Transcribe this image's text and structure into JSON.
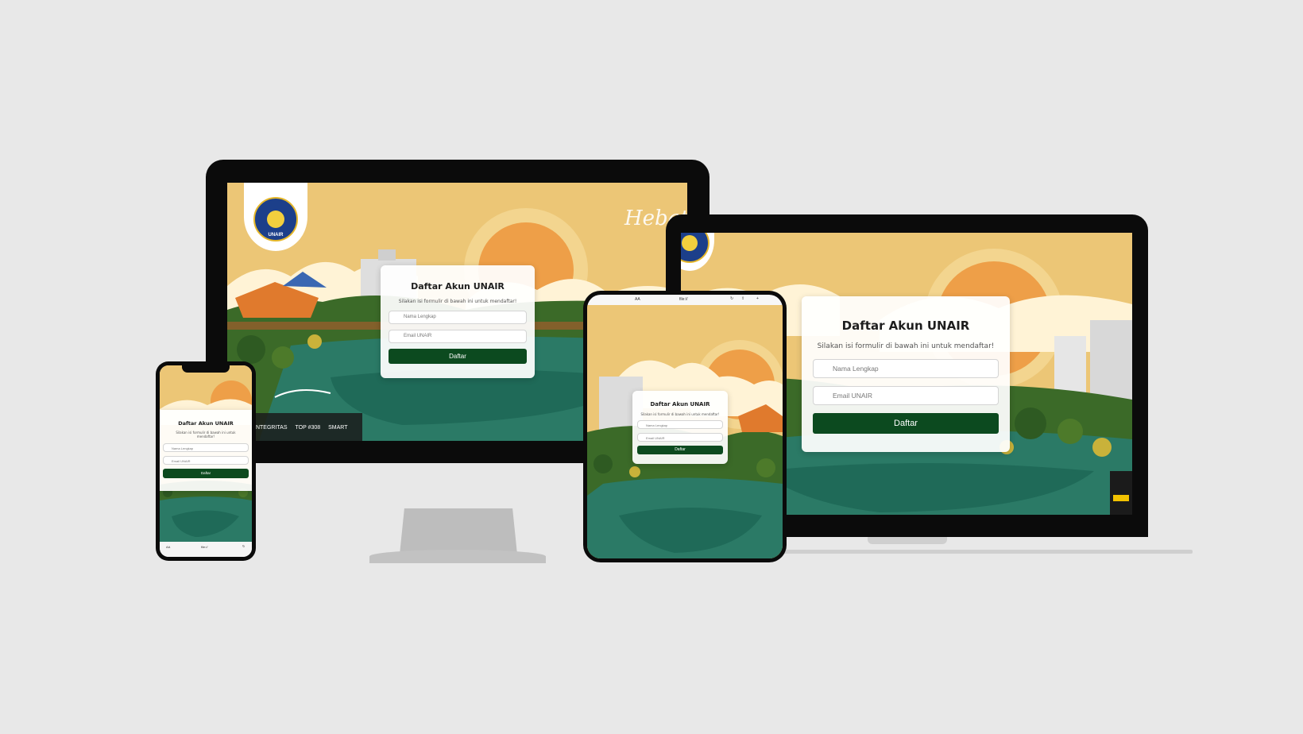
{
  "form": {
    "title": "Daftar Akun UNAIR",
    "subtitle": "Silakan isi formulir di bawah ini untuk mendaftar!",
    "name_placeholder": "Nama Lengkap",
    "email_placeholder": "Email UNAIR",
    "submit_label": "Daftar"
  },
  "branding": {
    "seal_text": "UNAIR",
    "tagline_partial": "Hebat",
    "badges": [
      "INTEGRITAS",
      "TOP #308",
      "SMART"
    ]
  },
  "browser": {
    "address_text": "file://",
    "reader_label": "AA"
  },
  "colors": {
    "background": "#e8e8e8",
    "sky": "#ecc676",
    "sun": "#ee9f48",
    "primary_button": "#0c4a1f",
    "water": "#2b7a66",
    "trees": "#2e5a22"
  }
}
